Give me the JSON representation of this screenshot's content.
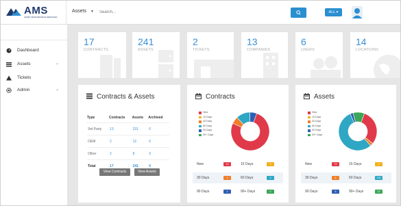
{
  "header": {
    "logo_text": "AMS",
    "logo_sub": "ASSET MAINTENANCE SERVICES",
    "asset_select": "Assets",
    "search_placeholder": "Search...",
    "filter_label": "ALL"
  },
  "sidebar": {
    "items": [
      {
        "label": "Dashboard",
        "icon": "dashboard-icon"
      },
      {
        "label": "Assets",
        "icon": "list-icon"
      },
      {
        "label": "Tickets",
        "icon": "warning-icon"
      },
      {
        "label": "Admin",
        "icon": "gear-icon"
      }
    ]
  },
  "stats": [
    {
      "value": "17",
      "label": "CONTRACTS"
    },
    {
      "value": "241",
      "label": "ASSETS"
    },
    {
      "value": "2",
      "label": "TICKETS"
    },
    {
      "value": "13",
      "label": "COMPANIES"
    },
    {
      "value": "6",
      "label": "USERS"
    },
    {
      "value": "14",
      "label": "LOCATIONS"
    }
  ],
  "contracts_assets": {
    "title": "Contracts & Assets",
    "headers": [
      "Type",
      "Contracts",
      "Assets",
      "Archived"
    ],
    "rows": [
      [
        "3rd Party",
        "13",
        "231",
        "0"
      ],
      [
        "OEM",
        "2",
        "12",
        "0"
      ],
      [
        "Other",
        "2",
        "8",
        "0"
      ]
    ],
    "total": [
      "Total",
      "17",
      "241",
      "0"
    ],
    "view_contracts": "View Contracts",
    "view_assets": "View Assets"
  },
  "contracts_panel": {
    "title": "Contracts",
    "legend": [
      "New",
      "15 Days",
      "30 Days",
      "60 Days",
      "90 Days",
      "90+ Days"
    ],
    "grid": [
      [
        {
          "label": "New",
          "value": "13"
        },
        {
          "label": "15 Days",
          "value": "0"
        }
      ],
      [
        {
          "label": "30 Days",
          "value": "1"
        },
        {
          "label": "60 Days",
          "value": "2"
        }
      ],
      [
        {
          "label": "90 Days",
          "value": "1"
        },
        {
          "label": "90+ Days",
          "value": "0"
        }
      ]
    ]
  },
  "assets_panel": {
    "title": "Assets",
    "legend": [
      "New",
      "15 Days",
      "30 Days",
      "60 Days",
      "90 Days",
      "90+ Days"
    ],
    "grid": [
      [
        {
          "label": "New",
          "value": "73"
        },
        {
          "label": "15 Days",
          "value": "0"
        }
      ],
      [
        {
          "label": "30 Days",
          "value": "6"
        },
        {
          "label": "60 Days",
          "value": "133"
        }
      ],
      [
        {
          "label": "90 Days",
          "value": "6"
        },
        {
          "label": "90+ Days",
          "value": "23"
        }
      ]
    ]
  },
  "colors": {
    "accent": "#2a8fd0",
    "new": "#e03a4a",
    "d15": "#f2b01e",
    "d30": "#f07f2a",
    "d60": "#2ea7c4",
    "d90": "#2f5fb3",
    "d90plus": "#3aa657"
  }
}
